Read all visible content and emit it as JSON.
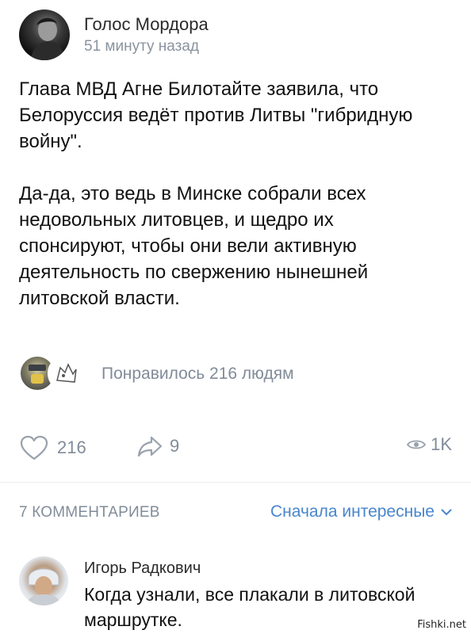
{
  "post": {
    "author": "Голос Мордора",
    "time": "51 минуту назад",
    "paragraphs": [
      "Глава МВД Агне Билотайте заявила, что\nБелоруссия ведёт против Литвы \"гибридную\nвойну\".",
      "Да-да, это ведь в Минске собрали всех\nнедовольных литовцев, и щедро их\nспонсируют, чтобы они вели активную\nдеятельность по свержению нынешней\nлитовской власти."
    ],
    "liked_text": "Понравилось 216 людям",
    "likes": "216",
    "shares": "9",
    "views": "1K"
  },
  "comments_section": {
    "count_label": "7 КОММЕНТАРИЕВ",
    "sort_label": "Сначала интересные"
  },
  "comment": {
    "author": "Игорь Радкович",
    "text": "Когда узнали, все плакали в литовской\nмаршрутке."
  },
  "watermark": "Fishki.net",
  "icons": {
    "like": "heart-icon",
    "share": "share-arrow-icon",
    "views": "eye-icon",
    "sort": "chevron-down-icon"
  },
  "colors": {
    "muted": "#818c99",
    "link": "#4986cc",
    "text": "#111111"
  }
}
